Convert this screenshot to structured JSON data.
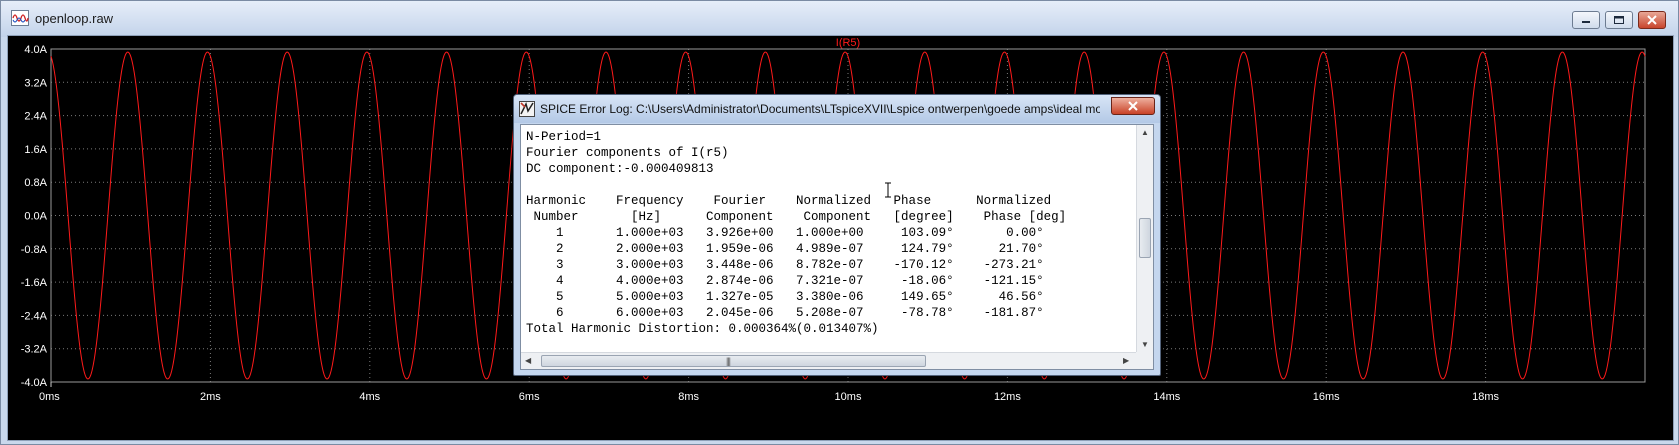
{
  "window": {
    "title": "openloop.raw",
    "icon": "waveform-viewer-icon"
  },
  "plot": {
    "trace_name": "I(R5)",
    "trace_color": "#ff1a1a",
    "background": "#000000",
    "grid_color": "#7a7a7a",
    "tick_label_color": "#ffffff"
  },
  "chart_data": {
    "type": "line",
    "title": "I(R5)",
    "xlabel": "",
    "ylabel": "",
    "x_unit": "ms",
    "y_unit": "A",
    "xlim": [
      0,
      20
    ],
    "ylim": [
      -4.0,
      4.0
    ],
    "x_ticks": [
      "0ms",
      "2ms",
      "4ms",
      "6ms",
      "8ms",
      "10ms",
      "12ms",
      "14ms",
      "16ms",
      "18ms"
    ],
    "x_tick_values": [
      0,
      2,
      4,
      6,
      8,
      10,
      12,
      14,
      16,
      18
    ],
    "y_ticks": [
      "4.0A",
      "3.2A",
      "2.4A",
      "1.6A",
      "0.8A",
      "0.0A",
      "-0.8A",
      "-1.6A",
      "-2.4A",
      "-3.2A",
      "-4.0A"
    ],
    "y_tick_values": [
      4.0,
      3.2,
      2.4,
      1.6,
      0.8,
      0.0,
      -0.8,
      -1.6,
      -2.4,
      -3.2,
      -4.0
    ],
    "grid": true,
    "series": [
      {
        "name": "I(R5)",
        "amplitude": 3.926,
        "frequency_khz": 1.0,
        "phase_deg": 103.09,
        "color": "#ff1a1a"
      }
    ]
  },
  "dialog": {
    "title": "SPICE Error Log: C:\\Users\\Administrator\\Documents\\LTspiceXVII\\Lspice ontwerpen\\goede amps\\ideal mo...",
    "icon": "ltspice-icon",
    "lines": [
      "N-Period=1",
      "Fourier components of I(r5)",
      "DC component:-0.000409813",
      "",
      "Harmonic    Frequency    Fourier    Normalized   Phase      Normalized",
      " Number       [Hz]      Component    Component   [degree]    Phase [deg]",
      "    1       1.000e+03   3.926e+00   1.000e+00     103.09°       0.00°",
      "    2       2.000e+03   1.959e-06   4.989e-07     124.79°      21.70°",
      "    3       3.000e+03   3.448e-06   8.782e-07    -170.12°    -273.21°",
      "    4       4.000e+03   2.874e-06   7.321e-07     -18.06°    -121.15°",
      "    5       5.000e+03   1.327e-05   3.380e-06     149.65°      46.56°",
      "    6       6.000e+03   2.045e-06   5.208e-07     -78.78°    -181.87°",
      "Total Harmonic Distortion: 0.000364%(0.013407%)"
    ],
    "hscroll_grip": "|||"
  }
}
